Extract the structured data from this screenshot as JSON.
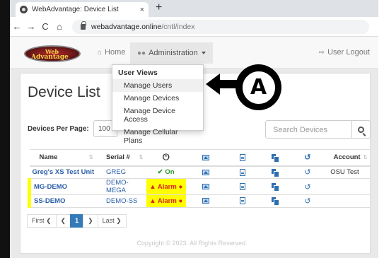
{
  "browser": {
    "tab_title": "WebAdvantage: Device List",
    "tab_close": "×",
    "new_tab": "+",
    "back": "←",
    "forward": "→",
    "reload": "C",
    "home": "⌂",
    "url_host": "webadvantage.online",
    "url_path": "/cntl/index"
  },
  "navbar": {
    "logo_line1": "Web",
    "logo_line2": "Advantage",
    "home_label": "Home",
    "admin_label": "Administration",
    "logout_label": "User Logout"
  },
  "dropdown": {
    "header": "User Views",
    "items": [
      "Manage Users",
      "Manage Devices",
      "Manage Device Access",
      "Manage Cellular Plans"
    ],
    "highlighted_index": 0
  },
  "page": {
    "title": "Device List",
    "per_page_label": "Devices Per Page:",
    "per_page_value": "100",
    "search_placeholder": "Search Devices"
  },
  "table": {
    "headers": [
      "Name",
      "Serial #",
      "Account"
    ],
    "rows": [
      {
        "name": "Greg's XS Test Unit",
        "serial": "GREG",
        "status": "✔ On",
        "account": "OSU Test"
      },
      {
        "name": "MG-DEMO",
        "serial": "DEMO-MEGA",
        "status": "▲ Alarm ●",
        "account": ""
      },
      {
        "name": "SS-DEMO",
        "serial": "DEMO-SS",
        "status": "▲ Alarm ●",
        "account": ""
      }
    ]
  },
  "pagination": {
    "first": "First ❮",
    "prev": "❮",
    "current": "1",
    "next": "❯",
    "last": "Last ❯"
  },
  "footer": "Copyright © 2023. All Rights Reserved.",
  "annotation": {
    "label": "A"
  },
  "colors": {
    "link": "#2a5da8",
    "alarm_bg": "#ffff00",
    "alarm_text": "#d9261c",
    "on_text": "#2e9a2e",
    "icon_blue": "#2f6fb0",
    "pager_active": "#337ab7"
  }
}
